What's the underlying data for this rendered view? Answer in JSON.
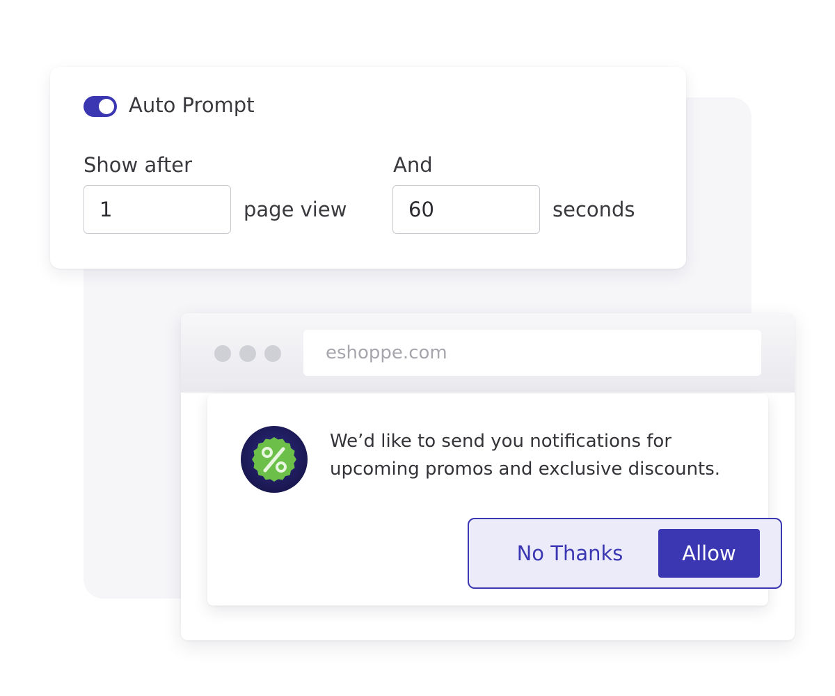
{
  "colors": {
    "accent": "#3b37b2",
    "accent_light": "#ecebfa",
    "badge_green": "#6cc04a",
    "badge_navy": "#1e1b5e"
  },
  "auto_prompt": {
    "toggle_label": "Auto Prompt",
    "enabled": true
  },
  "show_after": {
    "label": "Show after",
    "value": "1",
    "unit": "page view"
  },
  "and_delay": {
    "label": "And",
    "value": "60",
    "unit": "seconds"
  },
  "browser": {
    "url": "eshoppe.com"
  },
  "notification": {
    "icon": "percent-badge-icon",
    "message_line1": "We’d like to send you notifications for",
    "message_line2": "upcoming promos and exclusive discounts.",
    "decline_label": "No Thanks",
    "accept_label": "Allow"
  }
}
